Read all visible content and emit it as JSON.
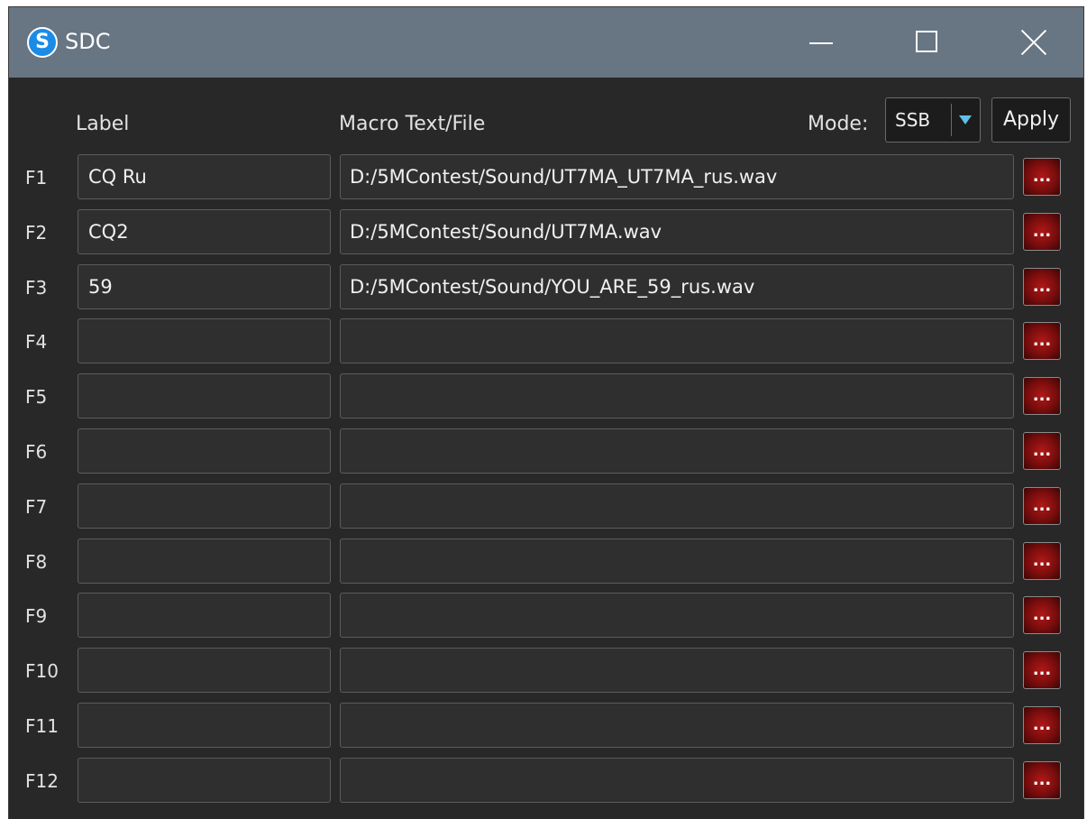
{
  "window": {
    "title": "SDC",
    "app_icon_letter": "S",
    "icons": {
      "app": "sdc-app-icon",
      "minimize": "minimize-icon",
      "maximize": "maximize-icon",
      "close": "close-icon"
    }
  },
  "headers": {
    "label": "Label",
    "macro": "Macro Text/File",
    "mode": "Mode:"
  },
  "mode_select": {
    "value": "SSB",
    "arrow_icon": "chevron-down-icon"
  },
  "apply_label": "Apply",
  "browse_label": "...",
  "rows": [
    {
      "key": "F1",
      "label": "CQ Ru",
      "macro": "D:/5MContest/Sound/UT7MA_UT7MA_rus.wav"
    },
    {
      "key": "F2",
      "label": "CQ2",
      "macro": "D:/5MContest/Sound/UT7MA.wav"
    },
    {
      "key": "F3",
      "label": "59",
      "macro": "D:/5MContest/Sound/YOU_ARE_59_rus.wav"
    },
    {
      "key": "F4",
      "label": "",
      "macro": ""
    },
    {
      "key": "F5",
      "label": "",
      "macro": ""
    },
    {
      "key": "F6",
      "label": "",
      "macro": ""
    },
    {
      "key": "F7",
      "label": "",
      "macro": ""
    },
    {
      "key": "F8",
      "label": "",
      "macro": ""
    },
    {
      "key": "F9",
      "label": "",
      "macro": ""
    },
    {
      "key": "F10",
      "label": "",
      "macro": ""
    },
    {
      "key": "F11",
      "label": "",
      "macro": ""
    },
    {
      "key": "F12",
      "label": "",
      "macro": ""
    }
  ],
  "colors": {
    "titlebar": "#687582",
    "body": "#282828",
    "field": "#2f2f2f",
    "browse_button": "#9a1212",
    "mode_arrow": "#5fc0e8"
  }
}
